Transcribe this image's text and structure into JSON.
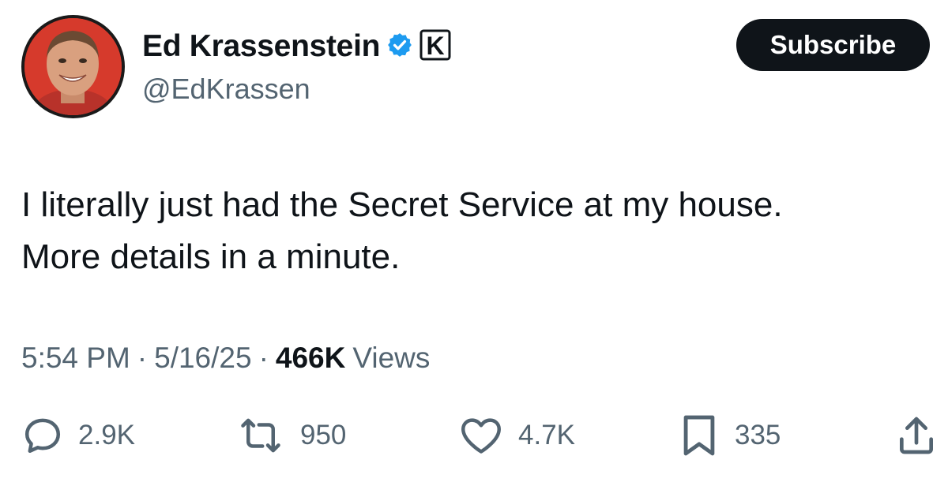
{
  "author": {
    "display_name": "Ed Krassenstein",
    "handle": "@EdKrassen",
    "affiliate_badge_letter": "K"
  },
  "header": {
    "subscribe_label": "Subscribe"
  },
  "tweet": {
    "text_line_1": "I literally just had the Secret Service at my house.",
    "text_line_2": "More details in a minute."
  },
  "meta": {
    "time": "5:54 PM",
    "separator": "·",
    "date": "5/16/25",
    "views_count": "466K",
    "views_label": "Views"
  },
  "actions": {
    "replies": "2.9K",
    "reposts": "950",
    "likes": "4.7K",
    "bookmarks": "335"
  },
  "icons": {
    "verified": "verified-badge-icon",
    "reply": "speech-bubble-icon",
    "repost": "repost-arrows-icon",
    "like": "heart-icon",
    "bookmark": "bookmark-icon",
    "share": "share-upload-icon"
  },
  "colors": {
    "verified_blue": "#1d9bf0",
    "text_primary": "#0f1419",
    "text_secondary": "#536471",
    "subscribe_bg": "#0f1419",
    "avatar_ring": "#d63a2c"
  }
}
